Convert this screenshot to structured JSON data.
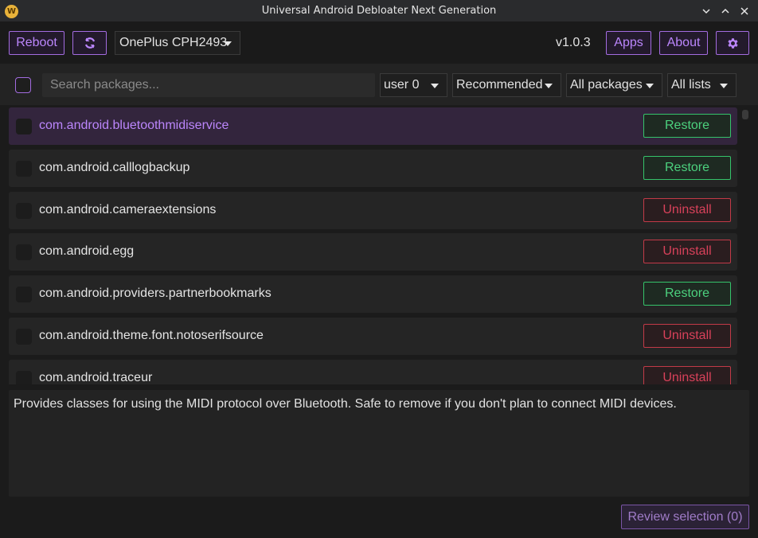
{
  "window": {
    "title": "Universal Android Debloater Next Generation",
    "app_icon_letter": "W"
  },
  "toolbar": {
    "reboot_label": "Reboot",
    "device": "OnePlus CPH2493",
    "version": "v1.0.3",
    "apps_label": "Apps",
    "about_label": "About"
  },
  "filters": {
    "search_placeholder": "Search packages...",
    "user": "user 0",
    "removal": "Recommended",
    "state": "All packages",
    "list": "All lists"
  },
  "packages": [
    {
      "name": "com.android.bluetoothmidiservice",
      "action": "Restore"
    },
    {
      "name": "com.android.calllogbackup",
      "action": "Restore"
    },
    {
      "name": "com.android.cameraextensions",
      "action": "Uninstall"
    },
    {
      "name": "com.android.egg",
      "action": "Uninstall"
    },
    {
      "name": "com.android.providers.partnerbookmarks",
      "action": "Restore"
    },
    {
      "name": "com.android.theme.font.notoserifsource",
      "action": "Uninstall"
    },
    {
      "name": "com.android.traceur",
      "action": "Uninstall"
    }
  ],
  "description": "Provides classes for using the MIDI protocol over Bluetooth. Safe to remove if you don't plan to connect MIDI devices.",
  "review_label": "Review selection (0)",
  "colors": {
    "accent": "#bb86fc",
    "restore": "#4cd17e",
    "uninstall": "#d8415a",
    "selected_row": "#33253d"
  },
  "icons": {
    "refresh": "refresh-icon",
    "settings": "gear-icon",
    "minimize": "chevron-down-icon",
    "maximize": "chevron-up-icon",
    "close": "close-icon"
  }
}
